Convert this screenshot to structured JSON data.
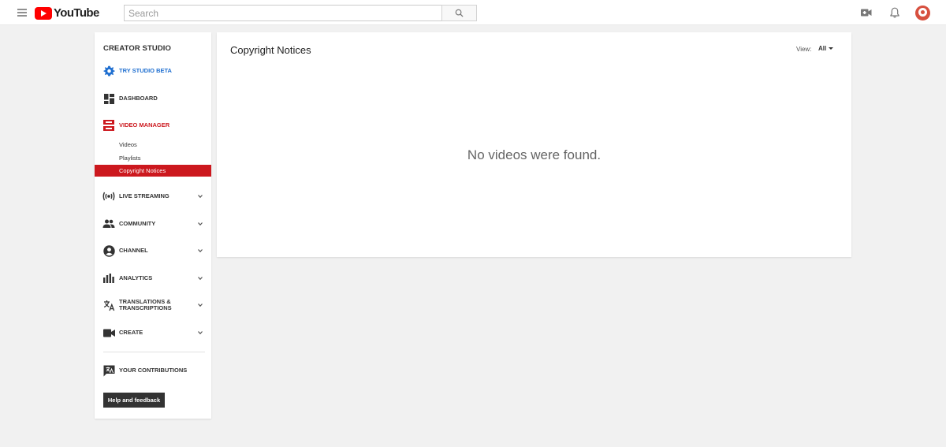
{
  "topbar": {
    "logo_text": "YouTube",
    "search_placeholder": "Search"
  },
  "sidebar": {
    "title": "CREATOR STUDIO",
    "items": [
      {
        "label": "TRY STUDIO BETA",
        "icon": "gear-icon",
        "color": "#1f6fd0"
      },
      {
        "label": "DASHBOARD",
        "icon": "dashboard-icon"
      },
      {
        "label": "VIDEO MANAGER",
        "icon": "video-manager-icon",
        "color": "#cc181e"
      },
      {
        "label": "LIVE STREAMING",
        "icon": "live-icon"
      },
      {
        "label": "COMMUNITY",
        "icon": "community-icon"
      },
      {
        "label": "CHANNEL",
        "icon": "channel-icon"
      },
      {
        "label": "ANALYTICS",
        "icon": "analytics-icon"
      },
      {
        "label": "TRANSLATIONS & TRANSCRIPTIONS",
        "icon": "translate-icon"
      },
      {
        "label": "CREATE",
        "icon": "camera-icon"
      },
      {
        "label": "YOUR CONTRIBUTIONS",
        "icon": "contributions-icon"
      }
    ],
    "sub_items": [
      {
        "label": "Videos"
      },
      {
        "label": "Playlists"
      },
      {
        "label": "Copyright Notices",
        "active": true
      }
    ],
    "help_label": "Help and feedback"
  },
  "main": {
    "title": "Copyright Notices",
    "view_label": "View:",
    "view_value": "All",
    "empty_message": "No videos were found."
  },
  "colors": {
    "accent_red": "#cc181e",
    "link_blue": "#1f6fd0",
    "background": "#f1f1f1"
  }
}
